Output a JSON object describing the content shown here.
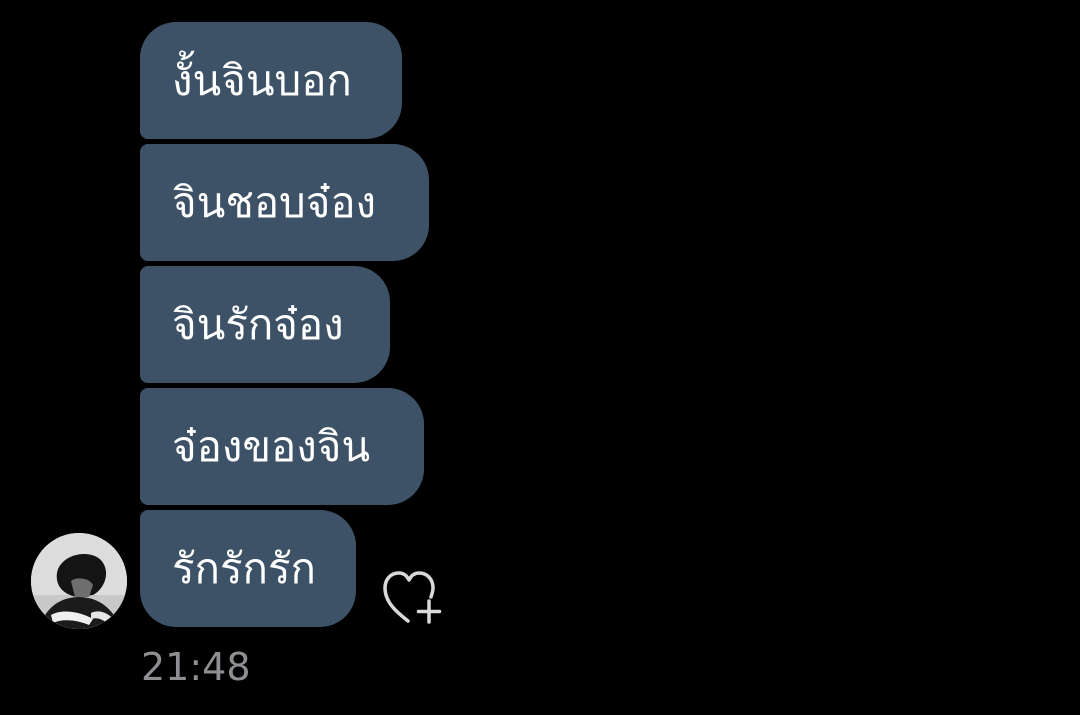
{
  "chat": {
    "messages": [
      {
        "text": "งั้นจินบอก"
      },
      {
        "text": "จินชอบจ๋อง"
      },
      {
        "text": "จินรักจ๋อง"
      },
      {
        "text": "จ๋องของจิน"
      },
      {
        "text": "รักรักรัก"
      }
    ],
    "timestamp": "21:48",
    "reaction_icon": "heart-plus-icon",
    "sender_avatar": "avatar",
    "colors": {
      "background": "#000000",
      "bubble": "#3d5266",
      "bubble_text": "#ffffff",
      "timestamp": "#8e8e93",
      "icon": "#d9d9d9"
    }
  }
}
